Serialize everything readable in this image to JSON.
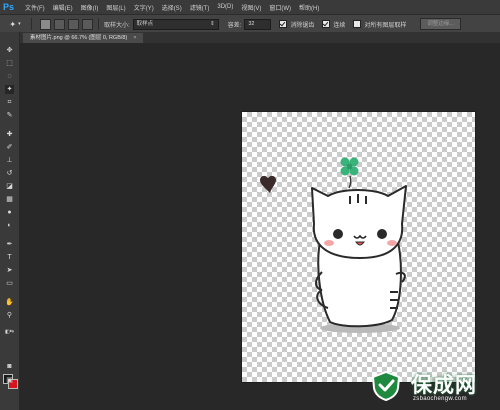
{
  "app": {
    "logo": "Ps"
  },
  "menu": [
    "文件(F)",
    "编辑(E)",
    "图像(I)",
    "图层(L)",
    "文字(Y)",
    "选择(S)",
    "滤镜(T)",
    "3D(D)",
    "视图(V)",
    "窗口(W)",
    "帮助(H)"
  ],
  "options": {
    "sample_size_label": "取样大小:",
    "sample_size_value": "取样点",
    "tolerance_label": "容差:",
    "tolerance_value": "32",
    "antialias_label": "消除锯齿",
    "antialias_checked": true,
    "contiguous_label": "连续",
    "contiguous_checked": true,
    "all_layers_label": "对所有图层取样",
    "all_layers_checked": false,
    "refine_edge_button": "调整边缘..."
  },
  "document_tab": {
    "title": "素材图片.png @ 66.7% (图层 0, RGB/8)",
    "close": "×"
  },
  "colors": {
    "foreground": "#1a1a1a",
    "background": "#d8141c",
    "watermark_green": "#1f8a3f"
  },
  "toolbar_icons": [
    "move-tool-icon",
    "marquee-tool-icon",
    "lasso-tool-icon",
    "magic-wand-tool-icon",
    "crop-tool-icon",
    "eyedropper-tool-icon",
    "healing-brush-tool-icon",
    "brush-tool-icon",
    "clone-stamp-tool-icon",
    "history-brush-tool-icon",
    "eraser-tool-icon",
    "gradient-tool-icon",
    "blur-tool-icon",
    "dodge-tool-icon",
    "pen-tool-icon",
    "type-tool-icon",
    "path-selection-tool-icon",
    "shape-tool-icon",
    "hand-tool-icon",
    "zoom-tool-icon"
  ],
  "watermark": {
    "title": "保成网",
    "url": "zsbaochengw.com"
  }
}
